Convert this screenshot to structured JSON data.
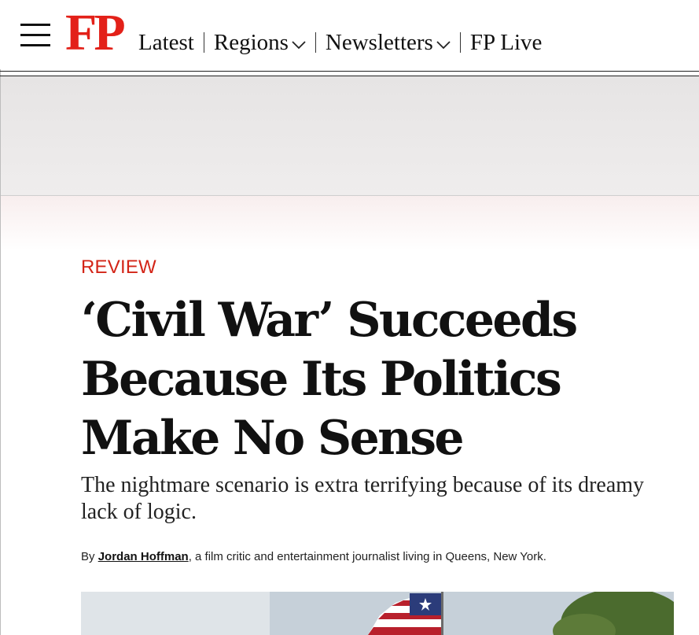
{
  "brand": {
    "logo_text": "FP",
    "logo_color": "#e32119"
  },
  "nav": {
    "items": [
      {
        "label": "Latest",
        "has_dropdown": false
      },
      {
        "label": "Regions",
        "has_dropdown": true
      },
      {
        "label": "Newsletters",
        "has_dropdown": true
      },
      {
        "label": "FP Live",
        "has_dropdown": false
      }
    ]
  },
  "article": {
    "kicker": "REVIEW",
    "kicker_color": "#d32417",
    "headline": "‘Civil War’ Succeeds Because Its Politics Make No Sense",
    "dek": "The nightmare scenario is extra terrifying because of its dreamy lack of logic.",
    "byline": {
      "prefix": "By ",
      "author": "Jordan Hoffman",
      "suffix": ", a film critic and entertainment journalist living in Queens, New York."
    }
  },
  "icons": {
    "menu": "hamburger-menu-icon",
    "dropdown": "chevron-down-icon"
  }
}
